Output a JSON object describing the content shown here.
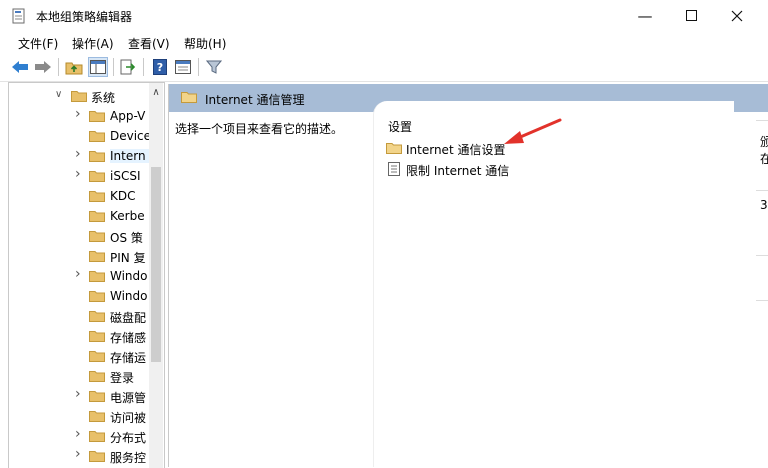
{
  "window": {
    "title": "本地组策略编辑器"
  },
  "menu": [
    "文件(F)",
    "操作(A)",
    "查看(V)",
    "帮助(H)"
  ],
  "tree": {
    "root": "系统",
    "items": [
      {
        "label": "App-V",
        "expandable": true
      },
      {
        "label": "Device",
        "expandable": false
      },
      {
        "label": "Intern",
        "expandable": true,
        "selected": true
      },
      {
        "label": "iSCSI",
        "expandable": true
      },
      {
        "label": "KDC",
        "expandable": false
      },
      {
        "label": "Kerbe",
        "expandable": false
      },
      {
        "label": "OS 策",
        "expandable": false
      },
      {
        "label": "PIN 复",
        "expandable": false
      },
      {
        "label": "Windo",
        "expandable": true
      },
      {
        "label": "Windo",
        "expandable": false
      },
      {
        "label": "磁盘配",
        "expandable": false
      },
      {
        "label": "存储感",
        "expandable": false
      },
      {
        "label": "存储运",
        "expandable": false
      },
      {
        "label": "登录",
        "expandable": false
      },
      {
        "label": "电源管",
        "expandable": true
      },
      {
        "label": "访问被",
        "expandable": false
      },
      {
        "label": "分布式",
        "expandable": true
      },
      {
        "label": "服务控",
        "expandable": true
      }
    ]
  },
  "content": {
    "header": "Internet 通信管理",
    "description": "选择一个项目来查看它的描述。",
    "list_header": "设置",
    "rows": [
      {
        "label": "Internet 通信设置",
        "type": "folder"
      },
      {
        "label": "限制 Internet 通信",
        "type": "policy"
      }
    ]
  },
  "edge_fragments": [
    "颁",
    "在",
    "3"
  ],
  "colors": {
    "header_bg": "#a7bcd6",
    "folder": "#e8c06a",
    "arrow": "#e2322b",
    "selection": "#e5f3ff"
  }
}
